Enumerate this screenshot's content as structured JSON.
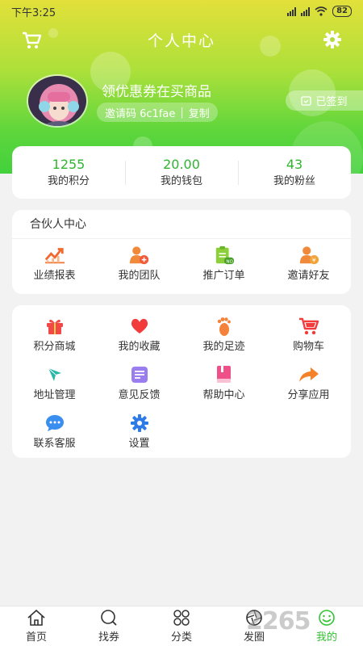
{
  "status_bar": {
    "time": "下午3:25",
    "battery": "82"
  },
  "header": {
    "title": "个人中心"
  },
  "user": {
    "name": "领优惠券在买商品",
    "invite_label": "邀请码 6c1fae",
    "copy_label": "复制",
    "signin_label": "已签到"
  },
  "stats": [
    {
      "value": "1255",
      "label": "我的积分"
    },
    {
      "value": "20.00",
      "label": "我的钱包"
    },
    {
      "value": "43",
      "label": "我的粉丝"
    }
  ],
  "partner": {
    "title": "合伙人中心",
    "items": [
      {
        "label": "业绩报表",
        "icon": "chart-icon"
      },
      {
        "label": "我的团队",
        "icon": "team-icon"
      },
      {
        "label": "推广订单",
        "icon": "order-icon"
      },
      {
        "label": "邀请好友",
        "icon": "invite-icon"
      }
    ]
  },
  "menu": {
    "items": [
      {
        "label": "积分商城",
        "icon": "gift-icon"
      },
      {
        "label": "我的收藏",
        "icon": "heart-icon"
      },
      {
        "label": "我的足迹",
        "icon": "footprint-icon"
      },
      {
        "label": "购物车",
        "icon": "cart-icon"
      },
      {
        "label": "地址管理",
        "icon": "location-icon"
      },
      {
        "label": "意见反馈",
        "icon": "feedback-icon"
      },
      {
        "label": "帮助中心",
        "icon": "book-icon"
      },
      {
        "label": "分享应用",
        "icon": "share-icon"
      },
      {
        "label": "联系客服",
        "icon": "chat-icon"
      },
      {
        "label": "设置",
        "icon": "gear-icon"
      }
    ]
  },
  "tabs": [
    {
      "label": "首页",
      "icon": "home-icon"
    },
    {
      "label": "找券",
      "icon": "search-icon"
    },
    {
      "label": "分类",
      "icon": "category-icon"
    },
    {
      "label": "发圈",
      "icon": "aperture-icon"
    },
    {
      "label": "我的",
      "icon": "profile-icon",
      "active": true
    }
  ],
  "watermark": "2265",
  "colors": {
    "accent": "#33c433",
    "header_top": "#e3e03a",
    "header_bottom": "#42d13c"
  }
}
